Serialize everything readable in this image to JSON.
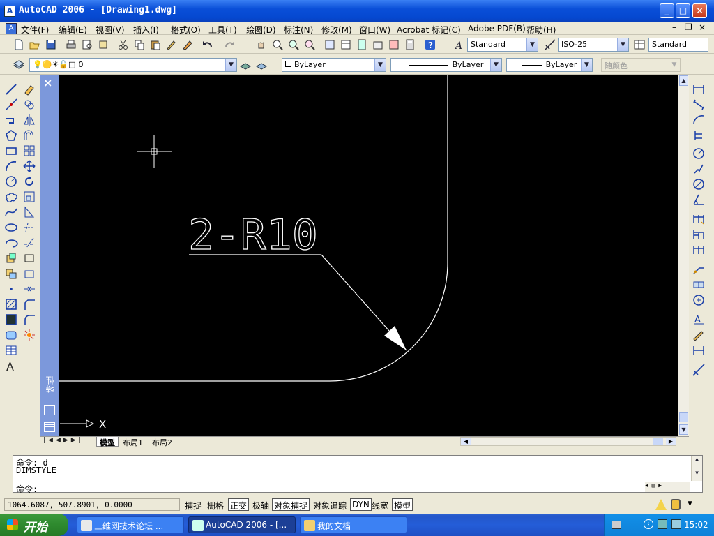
{
  "window": {
    "app_icon_label": "A",
    "title": "AutoCAD 2006 - [Drawing1.dwg]",
    "minimize": "_",
    "maximize": "□",
    "close": "×",
    "mdi_min": "–",
    "mdi_restore": "❐",
    "mdi_close": "×"
  },
  "menu": {
    "items": [
      "文件(F)",
      "编辑(E)",
      "视图(V)",
      "插入(I)",
      "格式(O)",
      "工具(T)",
      "绘图(D)",
      "标注(N)",
      "修改(M)",
      "窗口(W)",
      "Acrobat 标记(C)",
      "Adobe PDF(B)",
      "帮助(H)"
    ]
  },
  "toolbar": {
    "text_style": "Standard",
    "dim_style": "ISO-25",
    "table_style": "Standard",
    "layer_name": "0",
    "color": "ByLayer",
    "linetype": "ByLayer",
    "lineweight": "ByLayer",
    "plot_style": "随颜色"
  },
  "palette": {
    "close": "×",
    "title": "特性"
  },
  "drawing": {
    "annotation_text": "2-R10",
    "ucs_x_label": "X"
  },
  "tabs": {
    "items": [
      "模型",
      "布局1",
      "布局2"
    ],
    "active": "模型"
  },
  "command": {
    "history": [
      "命令: d",
      "DIMSTYLE"
    ],
    "prompt": "命令:"
  },
  "status": {
    "coordinates": "1064.6087, 507.8901, 0.0000",
    "buttons": [
      {
        "label": "捕捉",
        "on": false
      },
      {
        "label": "栅格",
        "on": false
      },
      {
        "label": "正交",
        "on": true
      },
      {
        "label": "极轴",
        "on": false
      },
      {
        "label": "对象捕捉",
        "on": true
      },
      {
        "label": "对象追踪",
        "on": false
      },
      {
        "label": "DYN",
        "on": true
      },
      {
        "label": "线宽",
        "on": false
      },
      {
        "label": "模型",
        "on": true
      }
    ]
  },
  "taskbar": {
    "start_label": "开始",
    "tasks": [
      "三维网技术论坛 ...",
      "AutoCAD 2006 - [...",
      "我的文档"
    ],
    "active_task": "AutoCAD 2006 - [...",
    "clock": "15:02"
  },
  "colors": {
    "canvas": "#000000",
    "drawing_lines": "#ffffff",
    "palette": "#7c98db",
    "titlebar": "#0a4fd8",
    "taskbar": "#245dd8",
    "start_button": "#2e8a2e"
  }
}
